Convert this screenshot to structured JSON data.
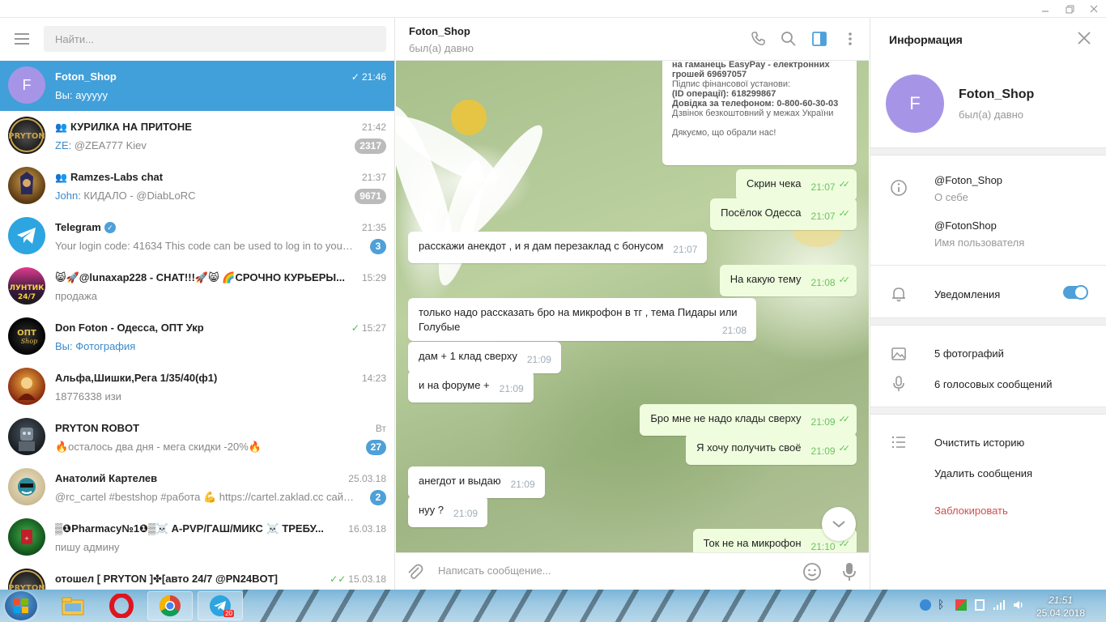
{
  "search": {
    "placeholder": "Найти..."
  },
  "dialogs": [
    {
      "name": "Foton_Shop",
      "time": "21:46",
      "sender": "",
      "message": "Вы: ayyyyy",
      "badge": "",
      "avatar_letter": "F"
    },
    {
      "name": "КУРИЛКА НА ПРИТОНЕ",
      "time": "21:42",
      "sender": "ZE:",
      "message": " @ZEA777 Kiev",
      "badge": "2317"
    },
    {
      "name": "Ramzes-Labs chat",
      "time": "21:37",
      "sender": "John:",
      "message": " КИДАЛО - @DiabLoRC",
      "badge": "9671"
    },
    {
      "name": "Telegram",
      "time": "21:35",
      "sender": "",
      "message": "Your login code: 41634  This code can be used to log in to your T...",
      "badge": "3"
    },
    {
      "name": "😸🚀@lunaxap228 - CHAT!!!🚀😸 🌈СРОЧНО КУРЬЕРЫ...",
      "time": "15:29",
      "sender": "",
      "message": "продажа",
      "badge": ""
    },
    {
      "name": "Don Foton - Одесса, ОПТ Укр",
      "time": "15:27",
      "sender": "Вы: Фотография",
      "message": "",
      "badge": ""
    },
    {
      "name": "Альфа,Шишки,Рега 1/35/40(ф1)",
      "time": "14:23",
      "sender": "",
      "message": "18776338 изи",
      "badge": ""
    },
    {
      "name": "PRYTON ROBOT",
      "time": "Вт",
      "sender": "",
      "message": "🔥осталось два дня - мега скидки -20%🔥",
      "badge": "27"
    },
    {
      "name": "Анатолий Картелев",
      "time": "25.03.18",
      "sender": "",
      "message": "@rc_cartel #bestshop #работа 💪 https://cartel.zaklad.cc сайт ...",
      "badge": "2"
    },
    {
      "name": "▒❶Pharmacy№1❶▒☠️ A-PVP/ГАШ/МИКС ☠️ ТРЕБУ...",
      "time": "16.03.18",
      "sender": "",
      "message": "пишу админу",
      "badge": ""
    },
    {
      "name": "отошел [ PRYTON ]✤[авто 24/7 @PN24BOT]",
      "time": "15.03.18",
      "sender": "",
      "message": "",
      "badge": ""
    }
  ],
  "chat": {
    "title": "Foton_Shop",
    "status": "был(а) давно",
    "receipt": {
      "line1": "на гаманець EasyPay - електронних",
      "line2": "грошей 69697057",
      "line3": "Підпис фінансової установи:",
      "line4": "(ID операції): 618299867",
      "line5": "Довідка за телефоном: 0-800-60-30-03",
      "line6": "Дзвінок безкоштовний у межах України",
      "line7": "Дякуємо, що обрали нас!"
    },
    "messages": [
      {
        "dir": "out",
        "text": "Скрин чека",
        "time": "21:07"
      },
      {
        "dir": "out",
        "text": "Посёлок Одесса",
        "time": "21:07"
      },
      {
        "dir": "in",
        "text": "расскажи анекдот , и я дам перезаклад с бонусом",
        "time": "21:07"
      },
      {
        "dir": "out",
        "text": "На какую тему",
        "time": "21:08"
      },
      {
        "dir": "in",
        "text": "только надо рассказать бро на микрофон в тг , тема Пидары или",
        "text2": "Голубые",
        "time": "21:08"
      },
      {
        "dir": "in",
        "text": "дам + 1 клад сверху",
        "time": "21:09"
      },
      {
        "dir": "in",
        "text": "и на форуме +",
        "time": "21:09"
      },
      {
        "dir": "out",
        "text": "Бро мне не надо клады сверху",
        "time": "21:09"
      },
      {
        "dir": "out",
        "text": "Я хочу получить своё",
        "time": "21:09"
      },
      {
        "dir": "in",
        "text": "анегдот и выдаю",
        "time": "21:09"
      },
      {
        "dir": "in",
        "text": "нуу ?",
        "time": "21:09"
      },
      {
        "dir": "out",
        "text": "Ток не на микрофон",
        "time": "21:10"
      }
    ],
    "compose_placeholder": "Написать сообщение..."
  },
  "info": {
    "title": "Информация",
    "name": "Foton_Shop",
    "status": "был(а) давно",
    "avatar_letter": "F",
    "bio": "@Foton_Shop",
    "bio_label": "О себе",
    "username": "@FotonShop",
    "username_label": "Имя пользователя",
    "notifications": "Уведомления",
    "notifications_on": true,
    "photos": "5 фотографий",
    "voice": "6 голосовых сообщений",
    "clear_history": "Очистить историю",
    "delete_messages": "Удалить сообщения",
    "block": "Заблокировать"
  },
  "taskbar": {
    "time": "21:51",
    "date": "25.04.2018",
    "telegram_badge": "20"
  },
  "colors": {
    "accent": "#419fd9",
    "badge": "#4fa0d8",
    "muted_badge": "#bbbbbb",
    "out_bubble": "#effdde",
    "danger": "#d14e4e",
    "avatar": "#a695e7"
  }
}
